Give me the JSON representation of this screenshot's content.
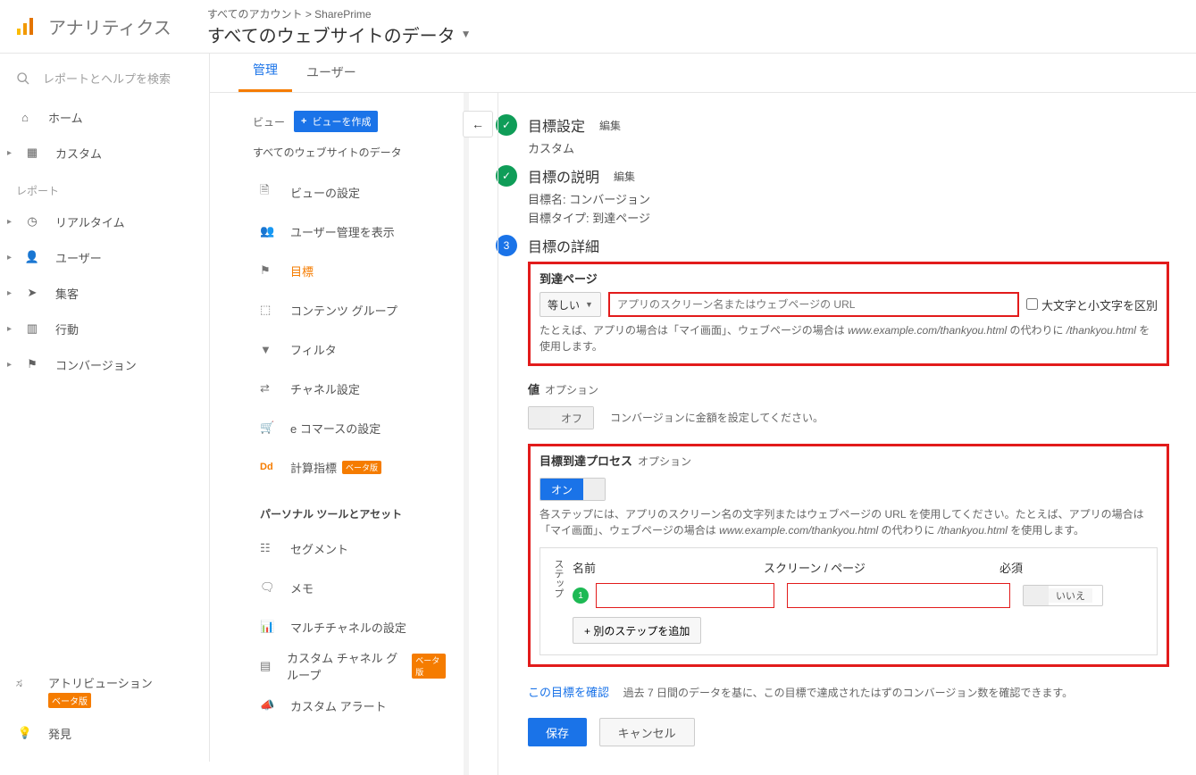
{
  "header": {
    "brand": "アナリティクス",
    "crumb_small": "すべてのアカウント > SharePrime",
    "crumb_big": "すべてのウェブサイトのデータ"
  },
  "leftnav": {
    "search_placeholder": "レポートとヘルプを検索",
    "home": "ホーム",
    "custom": "カスタム",
    "section": "レポート",
    "realtime": "リアルタイム",
    "user": "ユーザー",
    "acquisition": "集客",
    "behavior": "行動",
    "conversion": "コンバージョン",
    "attribution": "アトリビューション",
    "beta": "ベータ版",
    "discover": "発見"
  },
  "tabs": {
    "admin": "管理",
    "users": "ユーザー"
  },
  "admin": {
    "view_label": "ビュー",
    "create_view": "ビューを作成",
    "view_name": "すべてのウェブサイトのデータ",
    "items": {
      "settings": "ビューの設定",
      "user_mgmt": "ユーザー管理を表示",
      "goals": "目標",
      "content_group": "コンテンツ グループ",
      "filter": "フィルタ",
      "channel": "チャネル設定",
      "ecommerce": "e コマースの設定",
      "calc_metric": "計算指標",
      "calc_metric_badge": "ベータ版",
      "section": "パーソナル ツールとアセット",
      "segment": "セグメント",
      "memo": "メモ",
      "multichannel": "マルチチャネルの設定",
      "custom_channel": "カスタム チャネル グループ",
      "custom_channel_badge": "ベータ版",
      "custom_alert": "カスタム アラート"
    }
  },
  "goal": {
    "step1_title": "目標設定",
    "edit": "編集",
    "step1_sub": "カスタム",
    "step2_title": "目標の説明",
    "step2_name": "目標名: コンバージョン",
    "step2_type": "目標タイプ: 到達ページ",
    "step3_title": "目標の詳細",
    "dest_label": "到達ページ",
    "match_select": "等しい",
    "url_placeholder": "アプリのスクリーン名またはウェブページの URL",
    "case_label": "大文字と小文字を区別",
    "dest_help_a": "たとえば、アプリの場合は「マイ画面」、ウェブページの場合は ",
    "dest_help_i1": "www.example.com/thankyou.html",
    "dest_help_b": " の代わりに ",
    "dest_help_i2": "/thankyou.html",
    "dest_help_c": " を使用します。",
    "value_label": "値",
    "option": "オプション",
    "off": "オフ",
    "on": "オン",
    "value_help": "コンバージョンに金額を設定してください。",
    "funnel_label": "目標到達プロセス",
    "funnel_help_a": "各ステップには、アプリのスクリーン名の文字列またはウェブページの URL を使用してください。たとえば、アプリの場合は「マイ画面」、ウェブページの場合は ",
    "funnel_help_i1": "www.example.com/thankyou.html",
    "funnel_help_b": " の代わりに ",
    "funnel_help_i2": "/thankyou.html",
    "funnel_help_c": " を使用します。",
    "step_label": "ステップ",
    "col_name": "名前",
    "col_screen": "スクリーン / ページ",
    "col_required": "必須",
    "no": "いいえ",
    "add_step": "+ 別のステップを追加",
    "verify": "この目標を確認",
    "verify_help": "過去 7 日間のデータを基に、この目標で達成されたはずのコンバージョン数を確認できます。",
    "save": "保存",
    "cancel": "キャンセル",
    "step_num": "3"
  }
}
